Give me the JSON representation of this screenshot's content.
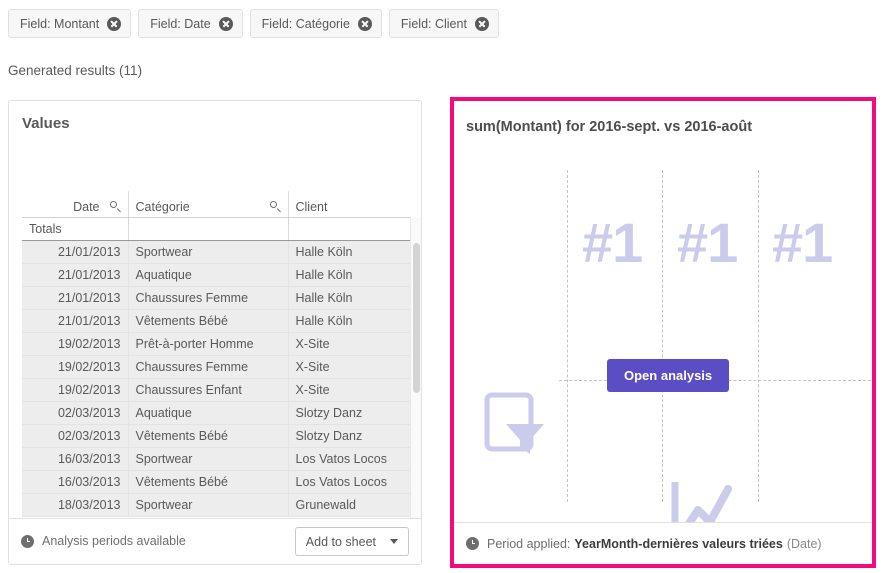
{
  "chips": [
    {
      "label": "Field: Montant",
      "close_icon": "close-circle-icon"
    },
    {
      "label": "Field: Date",
      "close_icon": "close-circle-icon"
    },
    {
      "label": "Field: Catégorie",
      "close_icon": "close-circle-icon"
    },
    {
      "label": "Field: Client",
      "close_icon": "close-circle-icon"
    }
  ],
  "generated_results": "Generated results (11)",
  "left_panel": {
    "title": "Values",
    "columns": [
      "Date",
      "Catégorie",
      "Client"
    ],
    "search_icons": [
      "search-icon",
      "search-icon"
    ],
    "totals_label": "Totals",
    "rows": [
      {
        "date": "21/01/2013",
        "categorie": "Sportwear",
        "client": "Halle Köln"
      },
      {
        "date": "21/01/2013",
        "categorie": "Aquatique",
        "client": "Halle Köln"
      },
      {
        "date": "21/01/2013",
        "categorie": "Chaussures Femme",
        "client": "Halle Köln"
      },
      {
        "date": "21/01/2013",
        "categorie": "Vêtements Bébé",
        "client": "Halle Köln"
      },
      {
        "date": "19/02/2013",
        "categorie": "Prêt-à-porter Homme",
        "client": "X-Site"
      },
      {
        "date": "19/02/2013",
        "categorie": "Chaussures Femme",
        "client": "X-Site"
      },
      {
        "date": "19/02/2013",
        "categorie": "Chaussures Enfant",
        "client": "X-Site"
      },
      {
        "date": "02/03/2013",
        "categorie": "Aquatique",
        "client": "Slotzy Danz"
      },
      {
        "date": "02/03/2013",
        "categorie": "Vêtements Bébé",
        "client": "Slotzy Danz"
      },
      {
        "date": "16/03/2013",
        "categorie": "Sportwear",
        "client": "Los Vatos Locos"
      },
      {
        "date": "16/03/2013",
        "categorie": "Vêtements Bébé",
        "client": "Los Vatos Locos"
      },
      {
        "date": "18/03/2013",
        "categorie": "Sportwear",
        "client": "Grunewald"
      }
    ],
    "footer": {
      "clock_icon": "clock-icon",
      "periods_text": "Analysis periods available",
      "add_button_label": "Add to sheet",
      "add_button_caret": "chevron-down-icon"
    }
  },
  "right_panel": {
    "title": "sum(Montant) for 2016-sept. vs 2016-août",
    "highlight_border_color": "#f5097e",
    "placeholder": {
      "rank_labels": [
        "#1",
        "#1",
        "#1"
      ],
      "filter_icon": "filter-icon",
      "line_chart_icon": "line-chart-icon",
      "placeholder_color": "#cbcbec"
    },
    "open_analysis_label": "Open analysis",
    "open_analysis_color": "#5b4ec4",
    "footer": {
      "clock_icon": "clock-icon",
      "label": "Period applied:",
      "value": "YearMonth-dernières valeurs triées",
      "field": "(Date)"
    }
  }
}
